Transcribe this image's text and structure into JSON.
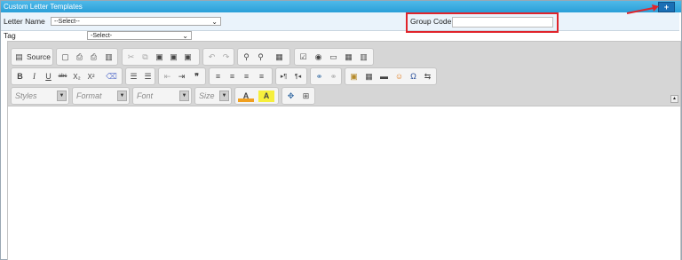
{
  "window": {
    "title": "Custom Letter Templates",
    "add_button": "+"
  },
  "form": {
    "letter_name_label": "Letter Name",
    "letter_name_value": "--Select--",
    "tag_label": "Tag",
    "tag_value": "-Select-",
    "group_code_label": "Group Code:",
    "group_code_value": ""
  },
  "toolbar": {
    "source_label": "Source",
    "styles_label": "Styles",
    "format_label": "Format",
    "font_label": "Font",
    "size_label": "Size",
    "row1_icons": [
      "new-page-icon",
      "preview-icon",
      "print-icon",
      "templates-icon",
      "cut-icon",
      "copy-icon",
      "paste-icon",
      "paste-text-icon",
      "paste-word-icon",
      "undo-icon",
      "redo-icon",
      "find-icon",
      "replace-icon",
      "select-all-icon",
      "form-icon",
      "radio-icon",
      "textfield-icon",
      "image-button-icon",
      "table-grid-icon"
    ],
    "row2_icons": [
      "bold-icon",
      "italic-icon",
      "underline-icon",
      "strike-icon",
      "subscript-icon",
      "superscript-icon",
      "remove-format-icon",
      "numbered-list-icon",
      "bulleted-list-icon",
      "outdent-icon",
      "indent-icon",
      "blockquote-icon",
      "align-left-icon",
      "align-center-icon",
      "align-right-icon",
      "justify-icon",
      "ltr-icon",
      "rtl-icon",
      "link-icon",
      "unlink-icon",
      "image-icon",
      "table-icon",
      "horizontal-rule-icon",
      "smiley-icon",
      "special-char-icon",
      "page-break-icon"
    ],
    "text_color_label": "A",
    "bg_color_label": "A",
    "bold_glyph": "B",
    "italic_glyph": "I",
    "underline_glyph": "U",
    "strike_glyph": "abc",
    "sub_glyph": "X₂",
    "sup_glyph": "X²",
    "quote_glyph": "❞",
    "omega_glyph": "Ω"
  },
  "colors": {
    "title_bar": "#2a9fd8",
    "highlight_box": "#e0242b",
    "add_button": "#1a6fb5"
  }
}
